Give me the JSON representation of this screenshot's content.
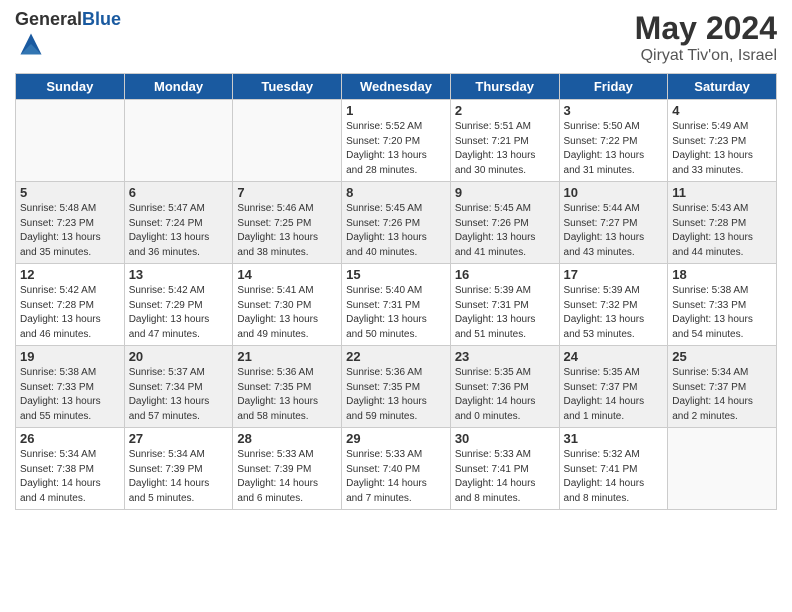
{
  "header": {
    "logo_general": "General",
    "logo_blue": "Blue",
    "month_year": "May 2024",
    "location": "Qiryat Tiv'on, Israel"
  },
  "weekdays": [
    "Sunday",
    "Monday",
    "Tuesday",
    "Wednesday",
    "Thursday",
    "Friday",
    "Saturday"
  ],
  "weeks": [
    [
      {
        "day": "",
        "info": ""
      },
      {
        "day": "",
        "info": ""
      },
      {
        "day": "",
        "info": ""
      },
      {
        "day": "1",
        "info": "Sunrise: 5:52 AM\nSunset: 7:20 PM\nDaylight: 13 hours\nand 28 minutes."
      },
      {
        "day": "2",
        "info": "Sunrise: 5:51 AM\nSunset: 7:21 PM\nDaylight: 13 hours\nand 30 minutes."
      },
      {
        "day": "3",
        "info": "Sunrise: 5:50 AM\nSunset: 7:22 PM\nDaylight: 13 hours\nand 31 minutes."
      },
      {
        "day": "4",
        "info": "Sunrise: 5:49 AM\nSunset: 7:23 PM\nDaylight: 13 hours\nand 33 minutes."
      }
    ],
    [
      {
        "day": "5",
        "info": "Sunrise: 5:48 AM\nSunset: 7:23 PM\nDaylight: 13 hours\nand 35 minutes."
      },
      {
        "day": "6",
        "info": "Sunrise: 5:47 AM\nSunset: 7:24 PM\nDaylight: 13 hours\nand 36 minutes."
      },
      {
        "day": "7",
        "info": "Sunrise: 5:46 AM\nSunset: 7:25 PM\nDaylight: 13 hours\nand 38 minutes."
      },
      {
        "day": "8",
        "info": "Sunrise: 5:45 AM\nSunset: 7:26 PM\nDaylight: 13 hours\nand 40 minutes."
      },
      {
        "day": "9",
        "info": "Sunrise: 5:45 AM\nSunset: 7:26 PM\nDaylight: 13 hours\nand 41 minutes."
      },
      {
        "day": "10",
        "info": "Sunrise: 5:44 AM\nSunset: 7:27 PM\nDaylight: 13 hours\nand 43 minutes."
      },
      {
        "day": "11",
        "info": "Sunrise: 5:43 AM\nSunset: 7:28 PM\nDaylight: 13 hours\nand 44 minutes."
      }
    ],
    [
      {
        "day": "12",
        "info": "Sunrise: 5:42 AM\nSunset: 7:28 PM\nDaylight: 13 hours\nand 46 minutes."
      },
      {
        "day": "13",
        "info": "Sunrise: 5:42 AM\nSunset: 7:29 PM\nDaylight: 13 hours\nand 47 minutes."
      },
      {
        "day": "14",
        "info": "Sunrise: 5:41 AM\nSunset: 7:30 PM\nDaylight: 13 hours\nand 49 minutes."
      },
      {
        "day": "15",
        "info": "Sunrise: 5:40 AM\nSunset: 7:31 PM\nDaylight: 13 hours\nand 50 minutes."
      },
      {
        "day": "16",
        "info": "Sunrise: 5:39 AM\nSunset: 7:31 PM\nDaylight: 13 hours\nand 51 minutes."
      },
      {
        "day": "17",
        "info": "Sunrise: 5:39 AM\nSunset: 7:32 PM\nDaylight: 13 hours\nand 53 minutes."
      },
      {
        "day": "18",
        "info": "Sunrise: 5:38 AM\nSunset: 7:33 PM\nDaylight: 13 hours\nand 54 minutes."
      }
    ],
    [
      {
        "day": "19",
        "info": "Sunrise: 5:38 AM\nSunset: 7:33 PM\nDaylight: 13 hours\nand 55 minutes."
      },
      {
        "day": "20",
        "info": "Sunrise: 5:37 AM\nSunset: 7:34 PM\nDaylight: 13 hours\nand 57 minutes."
      },
      {
        "day": "21",
        "info": "Sunrise: 5:36 AM\nSunset: 7:35 PM\nDaylight: 13 hours\nand 58 minutes."
      },
      {
        "day": "22",
        "info": "Sunrise: 5:36 AM\nSunset: 7:35 PM\nDaylight: 13 hours\nand 59 minutes."
      },
      {
        "day": "23",
        "info": "Sunrise: 5:35 AM\nSunset: 7:36 PM\nDaylight: 14 hours\nand 0 minutes."
      },
      {
        "day": "24",
        "info": "Sunrise: 5:35 AM\nSunset: 7:37 PM\nDaylight: 14 hours\nand 1 minute."
      },
      {
        "day": "25",
        "info": "Sunrise: 5:34 AM\nSunset: 7:37 PM\nDaylight: 14 hours\nand 2 minutes."
      }
    ],
    [
      {
        "day": "26",
        "info": "Sunrise: 5:34 AM\nSunset: 7:38 PM\nDaylight: 14 hours\nand 4 minutes."
      },
      {
        "day": "27",
        "info": "Sunrise: 5:34 AM\nSunset: 7:39 PM\nDaylight: 14 hours\nand 5 minutes."
      },
      {
        "day": "28",
        "info": "Sunrise: 5:33 AM\nSunset: 7:39 PM\nDaylight: 14 hours\nand 6 minutes."
      },
      {
        "day": "29",
        "info": "Sunrise: 5:33 AM\nSunset: 7:40 PM\nDaylight: 14 hours\nand 7 minutes."
      },
      {
        "day": "30",
        "info": "Sunrise: 5:33 AM\nSunset: 7:41 PM\nDaylight: 14 hours\nand 8 minutes."
      },
      {
        "day": "31",
        "info": "Sunrise: 5:32 AM\nSunset: 7:41 PM\nDaylight: 14 hours\nand 8 minutes."
      },
      {
        "day": "",
        "info": ""
      }
    ]
  ]
}
